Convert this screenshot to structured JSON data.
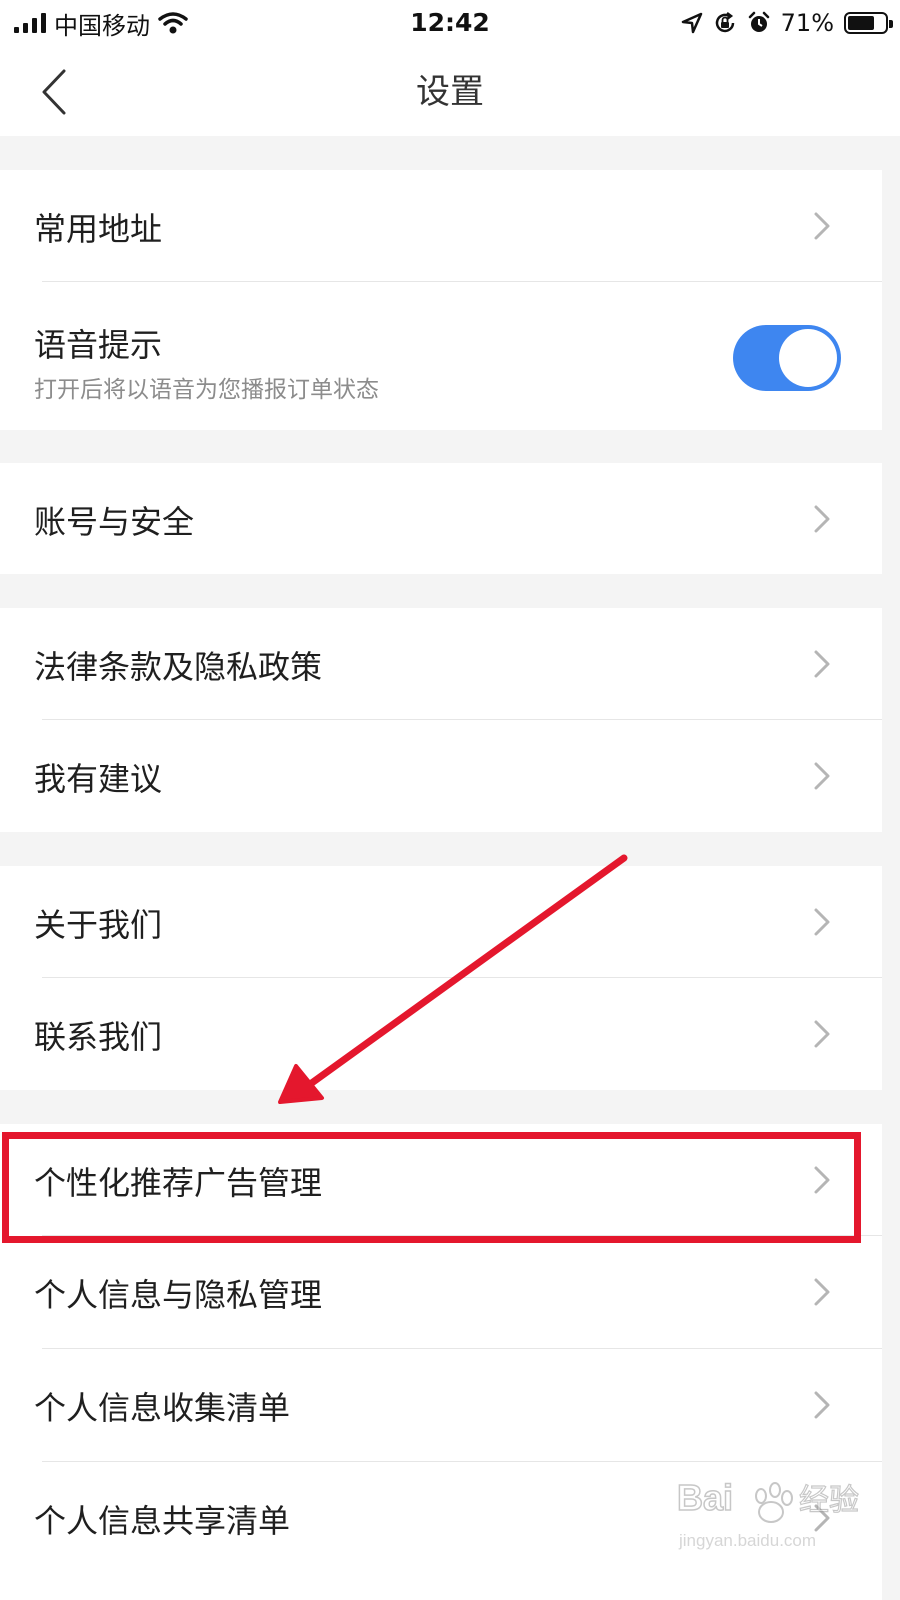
{
  "status_bar": {
    "carrier": "中国移动",
    "time": "12:42",
    "battery_percent": "71%",
    "battery_level": 0.71,
    "icons": [
      "signal-icon",
      "wifi-icon",
      "location-icon",
      "orientation-lock-icon",
      "alarm-icon",
      "battery-icon"
    ]
  },
  "nav": {
    "title": "设置",
    "back_icon": "chevron-left-icon"
  },
  "settings": {
    "address": {
      "label": "常用地址"
    },
    "voice": {
      "label": "语音提示",
      "description": "打开后将以语音为您播报订单状态",
      "enabled": true
    },
    "account": {
      "label": "账号与安全"
    },
    "legal": {
      "label": "法律条款及隐私政策"
    },
    "feedback": {
      "label": "我有建议"
    },
    "about": {
      "label": "关于我们"
    },
    "contact": {
      "label": "联系我们"
    },
    "ads": {
      "label": "个性化推荐广告管理"
    },
    "privacy": {
      "label": "个人信息与隐私管理"
    },
    "collection": {
      "label": "个人信息收集清单"
    },
    "sharing": {
      "label": "个人信息共享清单"
    }
  },
  "annotation": {
    "color": "#e4172d",
    "highlighted_item": "个性化推荐广告管理"
  },
  "watermark": {
    "logo_text": "Baidu经验",
    "url": "jingyan.baidu.com"
  },
  "colors": {
    "toggle_on": "#3e86f0",
    "background": "#f4f4f4",
    "row": "#ffffff"
  }
}
